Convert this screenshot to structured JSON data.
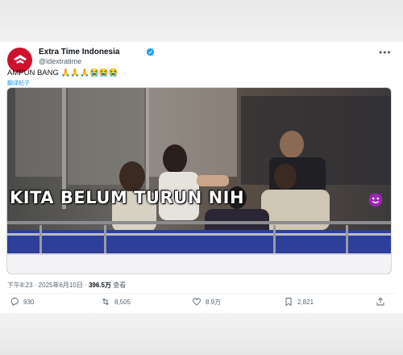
{
  "post": {
    "author_name": "Extra Time Indonesia",
    "author_handle": "@idextratime",
    "text": "AMPUN BANG 🙏🙏🙏😭😭😭",
    "translate_label": "翻译帖子",
    "image_caption": "KITA BELUM TURUN NIH",
    "timestamp": "下午8:23 · 2025年6月10日 · ",
    "views_count": "396.5万",
    "views_label": " 查看"
  },
  "actions": {
    "replies": "930",
    "reposts": "8,505",
    "likes": "8.9万",
    "bookmarks": "2,821"
  },
  "colors": {
    "brand_red": "#d0112b",
    "verified_blue": "#1d9bf0",
    "caption_emoji": "#9c27b0"
  },
  "icons": [
    "extratime-logo-icon",
    "verified-badge-icon",
    "more-options-icon",
    "devil-emoji-icon",
    "reply-icon",
    "repost-icon",
    "like-icon",
    "bookmark-icon",
    "share-icon"
  ]
}
